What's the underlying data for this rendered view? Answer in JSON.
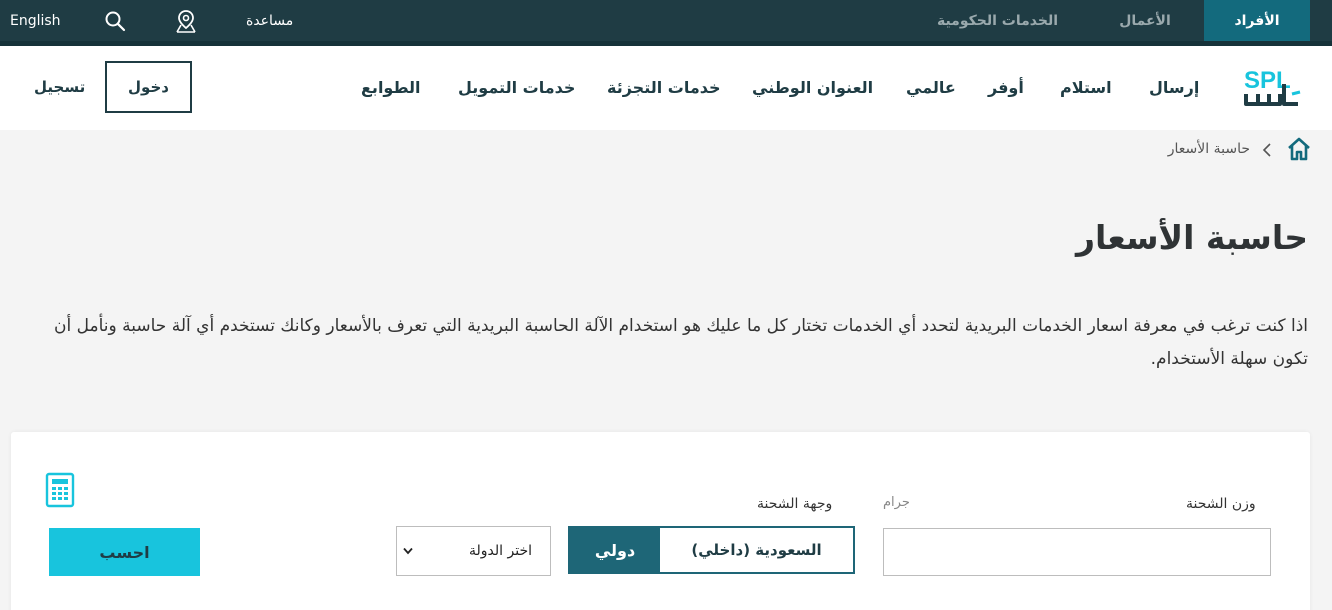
{
  "topbar": {
    "tabs": [
      {
        "label": "الأفراد",
        "active": true
      },
      {
        "label": "الأعمال",
        "active": false
      },
      {
        "label": "الخدمات الحكومية",
        "active": false
      }
    ],
    "help_label": "مساعدة",
    "language_label": "English",
    "location_icon": "map-pin-icon",
    "search_icon": "search-icon"
  },
  "logo": {
    "text": "SPL",
    "arabic": "سبل"
  },
  "nav": {
    "items": [
      "إرسال",
      "استلام",
      "أوفر",
      "عالمي",
      "العنوان الوطني",
      "خدمات التجزئة",
      "خدمات التمويل",
      "الطوابع"
    ],
    "login_label": "دخول",
    "register_label": "تسجيل"
  },
  "breadcrumb": {
    "home_icon": "home-icon",
    "current": "حاسبة الأسعار"
  },
  "page": {
    "title": "حاسبة الأسعار",
    "description": "اذا كنت ترغب في معرفة اسعار الخدمات البريدية لتحدد أي الخدمات تختار كل ما عليك هو استخدام الآلة الحاسبة البريدية التي تعرف بالأسعار وكانك تستخدم أي آلة حاسبة ونأمل أن تكون سهلة الأستخدام."
  },
  "calculator": {
    "icon": "calculator-icon",
    "weight_label": "وزن الشحنة",
    "weight_unit": "جرام",
    "weight_value": "",
    "destination_label": "وجهة الشحنة",
    "destination_options": [
      {
        "label": "السعودية (داخلي)",
        "selected": false
      },
      {
        "label": "دولي",
        "selected": true
      }
    ],
    "country_placeholder": "اختر الدولة",
    "calculate_label": "احسب"
  },
  "colors": {
    "topbar": "#1f3c44",
    "active_tab": "#136a7d",
    "accent": "#18c4dd",
    "segment_active": "#1e6677"
  }
}
